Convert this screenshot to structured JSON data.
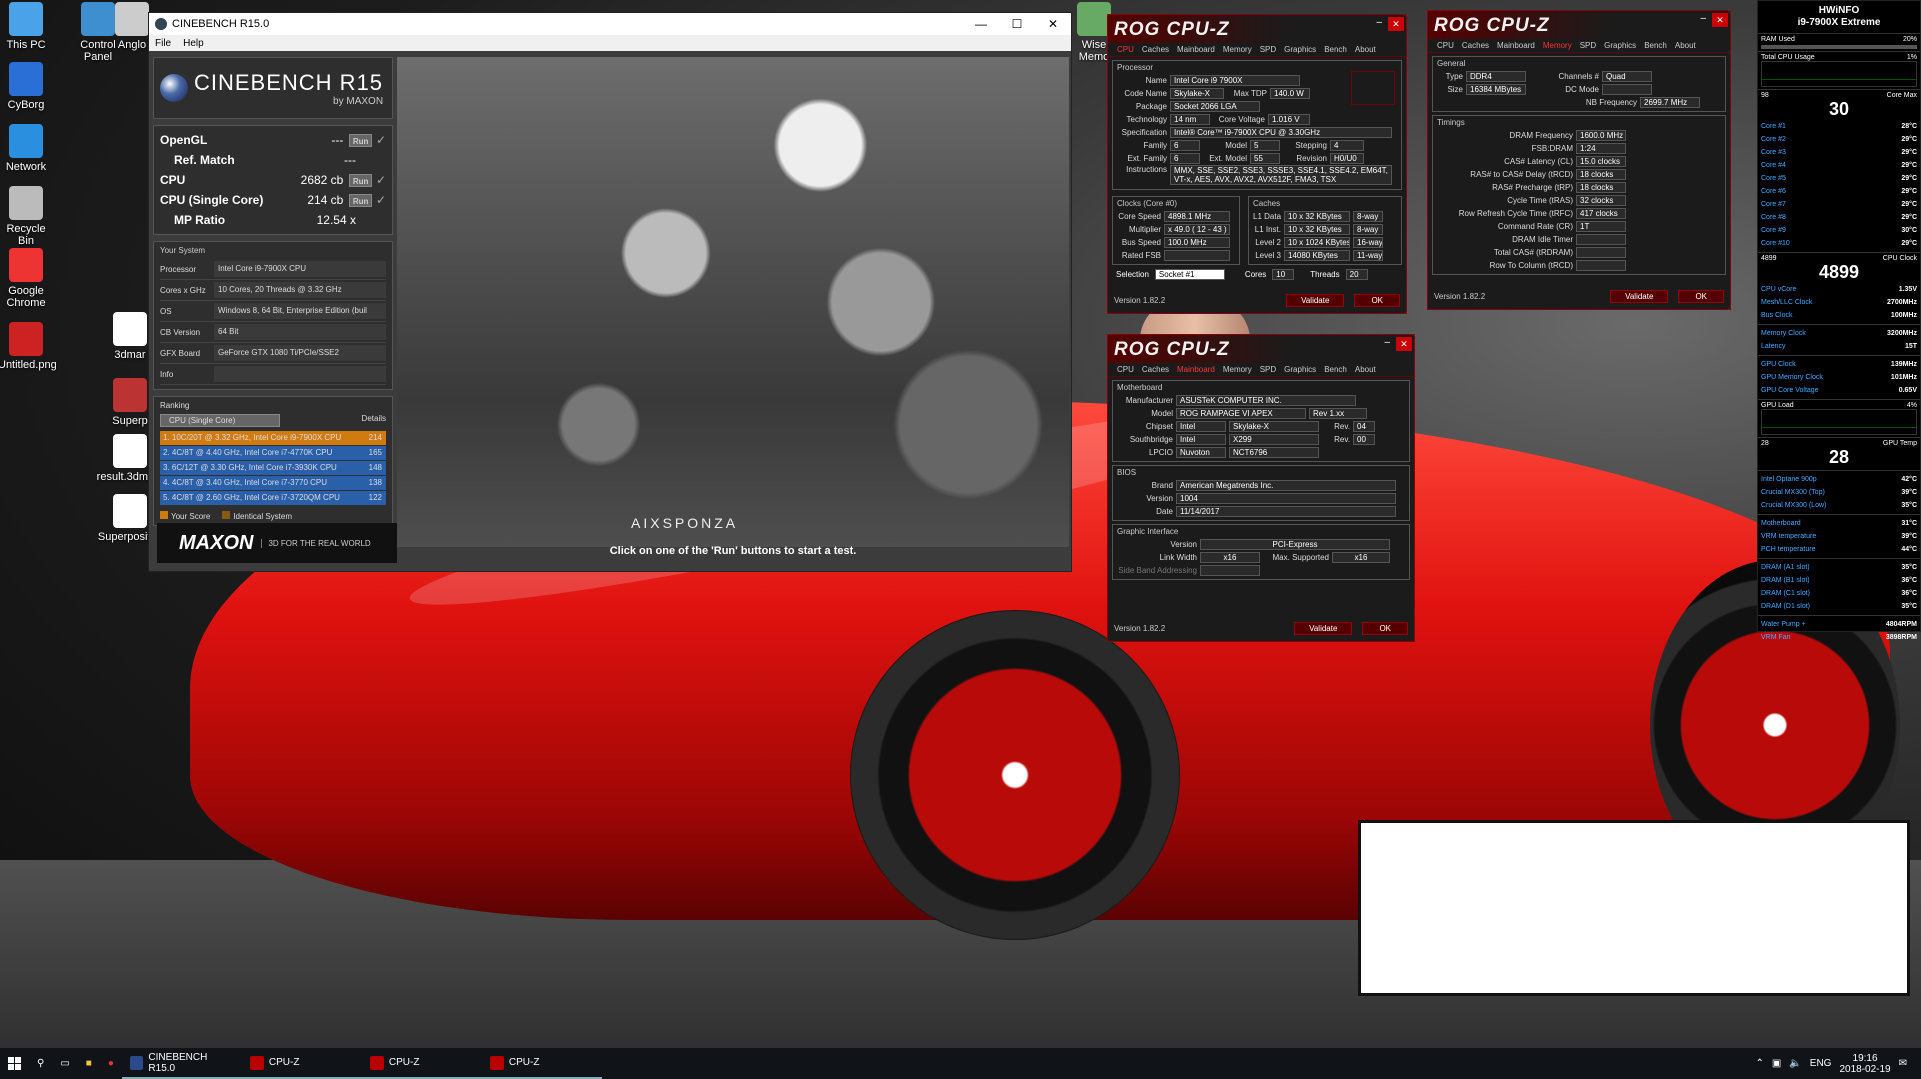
{
  "desktop": {
    "icons": [
      {
        "label": "This PC",
        "icon": "computer-icon",
        "color": "#4aa3e8"
      },
      {
        "label": "Control Panel",
        "icon": "control-panel-icon",
        "color": "#3d8fd0"
      },
      {
        "label": "Anglo",
        "icon": "app-icon",
        "color": "#ccc"
      },
      {
        "label": "CyBorg",
        "icon": "cyborg-icon",
        "color": "#2a6fd6"
      },
      {
        "label": "Network",
        "icon": "network-icon",
        "color": "#2b8fe0"
      },
      {
        "label": "Recycle Bin",
        "icon": "recycle-bin-icon",
        "color": "#bbb"
      },
      {
        "label": "Google Chrome",
        "icon": "chrome-icon",
        "color": "#e33"
      },
      {
        "label": "Untitled.png",
        "icon": "image-file-icon",
        "color": "#c22"
      },
      {
        "label": "3dmar",
        "icon": "file-icon",
        "color": "#fff"
      },
      {
        "label": "Superp",
        "icon": "app-icon",
        "color": "#b33"
      },
      {
        "label": "result.3dma...",
        "icon": "file-icon",
        "color": "#fff"
      },
      {
        "label": "Superpositi...",
        "icon": "file-icon",
        "color": "#fff"
      },
      {
        "label": "Wise Memo",
        "icon": "app-icon",
        "color": "#6a6"
      }
    ]
  },
  "cinebench": {
    "title": "CINEBENCH R15.0",
    "menu": [
      "File",
      "Help"
    ],
    "logo": {
      "name": "CINEBENCH R15",
      "by": "by MAXON"
    },
    "results": [
      {
        "label": "OpenGL",
        "value": "---",
        "run": "Run"
      },
      {
        "label": "Ref. Match",
        "value": "---",
        "run": ""
      },
      {
        "label": "CPU",
        "value": "2682 cb",
        "run": "Run"
      },
      {
        "label": "CPU (Single Core)",
        "value": "214 cb",
        "run": "Run"
      },
      {
        "label": "MP Ratio",
        "value": "12.54 x",
        "run": ""
      }
    ],
    "system": {
      "heading": "Your System",
      "rows": [
        {
          "k": "Processor",
          "v": "Intel Core i9-7900X CPU"
        },
        {
          "k": "Cores x GHz",
          "v": "10 Cores, 20 Threads @ 3.32 GHz"
        },
        {
          "k": "OS",
          "v": "Windows 8, 64 Bit, Enterprise Edition (buil"
        },
        {
          "k": "CB Version",
          "v": "64 Bit"
        },
        {
          "k": "GFX Board",
          "v": "GeForce GTX 1080 Ti/PCIe/SSE2"
        },
        {
          "k": "Info",
          "v": ""
        }
      ]
    },
    "ranking": {
      "heading": "Ranking",
      "select": "CPU (Single Core)",
      "details": "Details",
      "rows": [
        {
          "label": "1. 10C/20T @ 3.32 GHz, Intel Core i9-7900X CPU",
          "score": "214",
          "color": "#d17a10"
        },
        {
          "label": "2. 4C/8T @ 4.40 GHz, Intel Core i7-4770K CPU",
          "score": "165",
          "color": "#2a5faa"
        },
        {
          "label": "3. 6C/12T @ 3.30 GHz,  Intel Core i7-3930K CPU",
          "score": "148",
          "color": "#2a5faa"
        },
        {
          "label": "4. 4C/8T @ 3.40 GHz,  Intel Core i7-3770 CPU",
          "score": "138",
          "color": "#2a5faa"
        },
        {
          "label": "5. 4C/8T @ 2.60 GHz, Intel Core i7-3720QM CPU",
          "score": "122",
          "color": "#2a5faa"
        }
      ],
      "legend": [
        "Your Score",
        "Identical System"
      ]
    },
    "footer": {
      "brand": "MAXON",
      "tagline": "3D FOR THE REAL WORLD"
    },
    "render": {
      "watermark": "AIXSPONZA",
      "caption": "Click on one of the 'Run' buttons to start a test."
    }
  },
  "cpuz_cpu": {
    "title": "ROG CPU-Z",
    "tabs": [
      "CPU",
      "Caches",
      "Mainboard",
      "Memory",
      "SPD",
      "Graphics",
      "Bench",
      "About"
    ],
    "active": "CPU",
    "processor": [
      {
        "k": "Name",
        "v": "Intel Core i9 7900X"
      },
      {
        "k": "Code Name",
        "v": "Skylake-X"
      },
      {
        "k": "Max TDP",
        "v": "140.0 W"
      },
      {
        "k": "Package",
        "v": "Socket 2066 LGA"
      },
      {
        "k": "Technology",
        "v": "14 nm"
      },
      {
        "k": "Core Voltage",
        "v": "1.016 V"
      },
      {
        "k": "Specification",
        "v": "Intel® Core™ i9-7900X CPU @ 3.30GHz"
      },
      {
        "k": "Family",
        "v": "6"
      },
      {
        "k": "Model",
        "v": "5"
      },
      {
        "k": "Stepping",
        "v": "4"
      },
      {
        "k": "Ext. Family",
        "v": "6"
      },
      {
        "k": "Ext. Model",
        "v": "55"
      },
      {
        "k": "Revision",
        "v": "H0/U0"
      },
      {
        "k": "Instructions",
        "v": "MMX, SSE, SSE2, SSE3, SSSE3, SSE4.1, SSE4.2, EM64T, VT-x, AES, AVX, AVX2, AVX512F, FMA3, TSX"
      }
    ],
    "clocks_heading": "Clocks (Core #0)",
    "clocks": [
      {
        "k": "Core Speed",
        "v": "4898.1 MHz"
      },
      {
        "k": "Multiplier",
        "v": "x 49.0 ( 12 - 43 )"
      },
      {
        "k": "Bus Speed",
        "v": "100.0 MHz"
      },
      {
        "k": "Rated FSB",
        "v": ""
      }
    ],
    "caches_heading": "Caches",
    "caches": [
      {
        "k": "L1 Data",
        "v": "10 x 32 KBytes",
        "w": "8-way"
      },
      {
        "k": "L1 Inst.",
        "v": "10 x 32 KBytes",
        "w": "8-way"
      },
      {
        "k": "Level 2",
        "v": "10 x 1024 KBytes",
        "w": "16-way"
      },
      {
        "k": "Level 3",
        "v": "14080 KBytes",
        "w": "11-way"
      }
    ],
    "selection": "Socket #1",
    "cores": "10",
    "threads": "20",
    "labels": {
      "selection": "Selection",
      "cores": "Cores",
      "threads": "Threads",
      "processor": "Processor"
    },
    "version": "Version 1.82.2",
    "validate": "Validate",
    "ok": "OK"
  },
  "cpuz_mem": {
    "title": "ROG CPU-Z",
    "tabs": [
      "CPU",
      "Caches",
      "Mainboard",
      "Memory",
      "SPD",
      "Graphics",
      "Bench",
      "About"
    ],
    "active": "Memory",
    "general_heading": "General",
    "general": [
      {
        "k": "Type",
        "v": "DDR4"
      },
      {
        "k": "Channels #",
        "v": "Quad"
      },
      {
        "k": "Size",
        "v": "16384 MBytes"
      },
      {
        "k": "DC Mode",
        "v": ""
      },
      {
        "k": "NB Frequency",
        "v": "2699.7 MHz"
      }
    ],
    "timings_heading": "Timings",
    "timings": [
      {
        "k": "DRAM Frequency",
        "v": "1600.0 MHz"
      },
      {
        "k": "FSB:DRAM",
        "v": "1:24"
      },
      {
        "k": "CAS# Latency (CL)",
        "v": "15.0 clocks"
      },
      {
        "k": "RAS# to CAS# Delay (tRCD)",
        "v": "18 clocks"
      },
      {
        "k": "RAS# Precharge (tRP)",
        "v": "18 clocks"
      },
      {
        "k": "Cycle Time (tRAS)",
        "v": "32 clocks"
      },
      {
        "k": "Row Refresh Cycle Time (tRFC)",
        "v": "417 clocks"
      },
      {
        "k": "Command Rate (CR)",
        "v": "1T"
      },
      {
        "k": "DRAM Idle Timer",
        "v": ""
      },
      {
        "k": "Total CAS# (tRDRAM)",
        "v": ""
      },
      {
        "k": "Row To Column (tRCD)",
        "v": ""
      }
    ],
    "version": "Version 1.82.2",
    "validate": "Validate",
    "ok": "OK"
  },
  "cpuz_mb": {
    "title": "ROG CPU-Z",
    "tabs": [
      "CPU",
      "Caches",
      "Mainboard",
      "Memory",
      "SPD",
      "Graphics",
      "Bench",
      "About"
    ],
    "active": "Mainboard",
    "mb_heading": "Motherboard",
    "mb": [
      {
        "k": "Manufacturer",
        "v": "ASUSTeK COMPUTER INC."
      },
      {
        "k": "Model",
        "v": "ROG RAMPAGE VI APEX",
        "extra": "Rev 1.xx"
      },
      {
        "k": "Chipset",
        "v": "Intel",
        "v2": "Skylake-X",
        "rl": "Rev.",
        "rv": "04"
      },
      {
        "k": "Southbridge",
        "v": "Intel",
        "v2": "X299",
        "rl": "Rev.",
        "rv": "00"
      },
      {
        "k": "LPCIO",
        "v": "Nuvoton",
        "v2": "NCT6796"
      }
    ],
    "bios_heading": "BIOS",
    "bios": [
      {
        "k": "Brand",
        "v": "American Megatrends Inc."
      },
      {
        "k": "Version",
        "v": "1004"
      },
      {
        "k": "Date",
        "v": "11/14/2017"
      }
    ],
    "gi_heading": "Graphic Interface",
    "gi": {
      "version_label": "Version",
      "version": "PCI-Express",
      "lw_label": "Link Width",
      "lw": "x16",
      "ms_label": "Max. Supported",
      "ms": "x16",
      "sba_label": "Side Band Addressing"
    },
    "version": "Version 1.82.2",
    "validate": "Validate",
    "ok": "OK"
  },
  "hwinfo": {
    "title": "HWiNFO",
    "subtitle": "i9-7900X Extreme",
    "ram_used": {
      "label": "RAM Used",
      "value": "20%"
    },
    "cpu_usage": {
      "label": "Total CPU Usage",
      "value": "1%",
      "top": "100",
      "bottom": "0"
    },
    "core_max": {
      "label": "Core Max",
      "value": "30",
      "left": "98",
      "right": "°C"
    },
    "cores": [
      {
        "k": "Core #1",
        "v": "28°C"
      },
      {
        "k": "Core #2",
        "v": "29°C"
      },
      {
        "k": "Core #3",
        "v": "29°C"
      },
      {
        "k": "Core #4",
        "v": "29°C"
      },
      {
        "k": "Core #5",
        "v": "29°C"
      },
      {
        "k": "Core #6",
        "v": "29°C"
      },
      {
        "k": "Core #7",
        "v": "29°C"
      },
      {
        "k": "Core #8",
        "v": "29°C"
      },
      {
        "k": "Core #9",
        "v": "30°C"
      },
      {
        "k": "Core #10",
        "v": "29°C"
      }
    ],
    "clock": {
      "label": "CPU Clock",
      "value": "4899",
      "left1": "4899",
      "left2": "4900",
      "unit": "MHz"
    },
    "volt": [
      {
        "k": "CPU vCore",
        "v": "1.35V"
      },
      {
        "k": "Mesh/LLC Clock",
        "v": "2700MHz"
      },
      {
        "k": "Bus Clock",
        "v": "100MHz"
      }
    ],
    "memory": [
      {
        "k": "Memory Clock",
        "v": "3200MHz"
      },
      {
        "k": "Latency",
        "v": "15T"
      }
    ],
    "gpu": [
      {
        "k": "GPU Clock",
        "v": "139MHz"
      },
      {
        "k": "GPU Memory Clock",
        "v": "101MHz"
      },
      {
        "k": "GPU Core Voltage",
        "v": "0.65V"
      }
    ],
    "gpu_load": {
      "label": "GPU Load",
      "value": "4%",
      "top": "100",
      "bottom": "0"
    },
    "gpu_temp": {
      "label": "GPU Temp",
      "value": "28",
      "left": "28",
      "unit": "°C"
    },
    "storage": [
      {
        "k": "Intel Optane 900p",
        "v": "42°C"
      },
      {
        "k": "Crucial MX300 (Top)",
        "v": "39°C"
      },
      {
        "k": "Crucial MX300 (Low)",
        "v": "35°C"
      }
    ],
    "board": [
      {
        "k": "Motherboard",
        "v": "31°C"
      },
      {
        "k": "VRM temperature",
        "v": "39°C"
      },
      {
        "k": "PCH temperature",
        "v": "44°C"
      }
    ],
    "dimms": [
      {
        "k": "DRAM (A1 slot)",
        "v": "35°C"
      },
      {
        "k": "DRAM (B1 slot)",
        "v": "36°C"
      },
      {
        "k": "DRAM (C1 slot)",
        "v": "36°C"
      },
      {
        "k": "DRAM (D1 slot)",
        "v": "35°C"
      }
    ],
    "fans": [
      {
        "k": "Water Pump +",
        "v": "4804RPM"
      },
      {
        "k": "VRM Fan",
        "v": "3898RPM"
      }
    ]
  },
  "taskbar": {
    "apps": [
      {
        "label": "CINEBENCH R15.0",
        "icon": "cinebench-icon"
      },
      {
        "label": "CPU-Z",
        "icon": "cpuz-icon"
      },
      {
        "label": "CPU-Z",
        "icon": "cpuz-icon"
      },
      {
        "label": "CPU-Z",
        "icon": "cpuz-icon"
      }
    ],
    "lang": "ENG",
    "time": "19:16",
    "date": "2018-02-19"
  }
}
